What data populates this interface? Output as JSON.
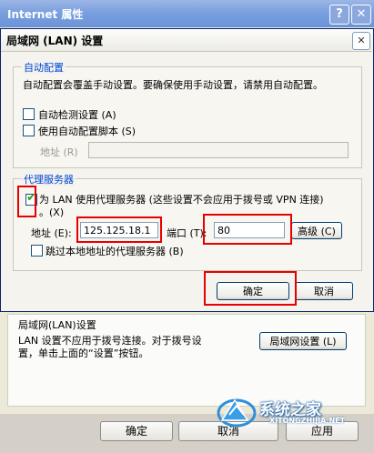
{
  "outer_window": {
    "title": "Internet 属性",
    "help_button": "?",
    "close_button": "✕",
    "lan_group_title": "局域网(LAN)设置",
    "lan_group_text_lines": [
      "LAN 设置不应用于拨号连接。对于拨号设",
      "置，单击上面的“设置”按钮。"
    ],
    "lan_settings_button": "局域网设置 (L)",
    "ok_button": "确定",
    "cancel_button": "取消",
    "apply_button": "应用"
  },
  "dialog": {
    "title": "局域网 (LAN) 设置",
    "close_button": "✕",
    "auto_config": {
      "group_title": "自动配置",
      "description": "自动配置会覆盖手动设置。要确保使用手动设置，请禁用自动配置。",
      "auto_detect_label": "自动检测设置 (A)",
      "auto_detect_checked": false,
      "use_script_label": "使用自动配置脚本 (S)",
      "use_script_checked": false,
      "address_label": "地址 (R)",
      "address_value": ""
    },
    "proxy": {
      "group_title": "代理服务器",
      "use_proxy_label_line1": "为 LAN 使用代理服务器 (这些设置不会应用于拨号或 VPN 连接)",
      "use_proxy_label_line2": "。(X)",
      "use_proxy_checked": true,
      "check_glyph": "✔",
      "address_label": "地址 (E):",
      "address_value": "125.125.18.1",
      "port_label": "端口 (T):",
      "port_value": "80",
      "advanced_button": "高级 (C)",
      "bypass_label": "跳过本地地址的代理服务器 (B)",
      "bypass_checked": false
    },
    "ok_button": "确定",
    "cancel_button": "取消"
  },
  "watermark": {
    "text": "系统之家",
    "url": "XITONGZHIJIA.NET"
  },
  "highlight_color": "#e60000"
}
